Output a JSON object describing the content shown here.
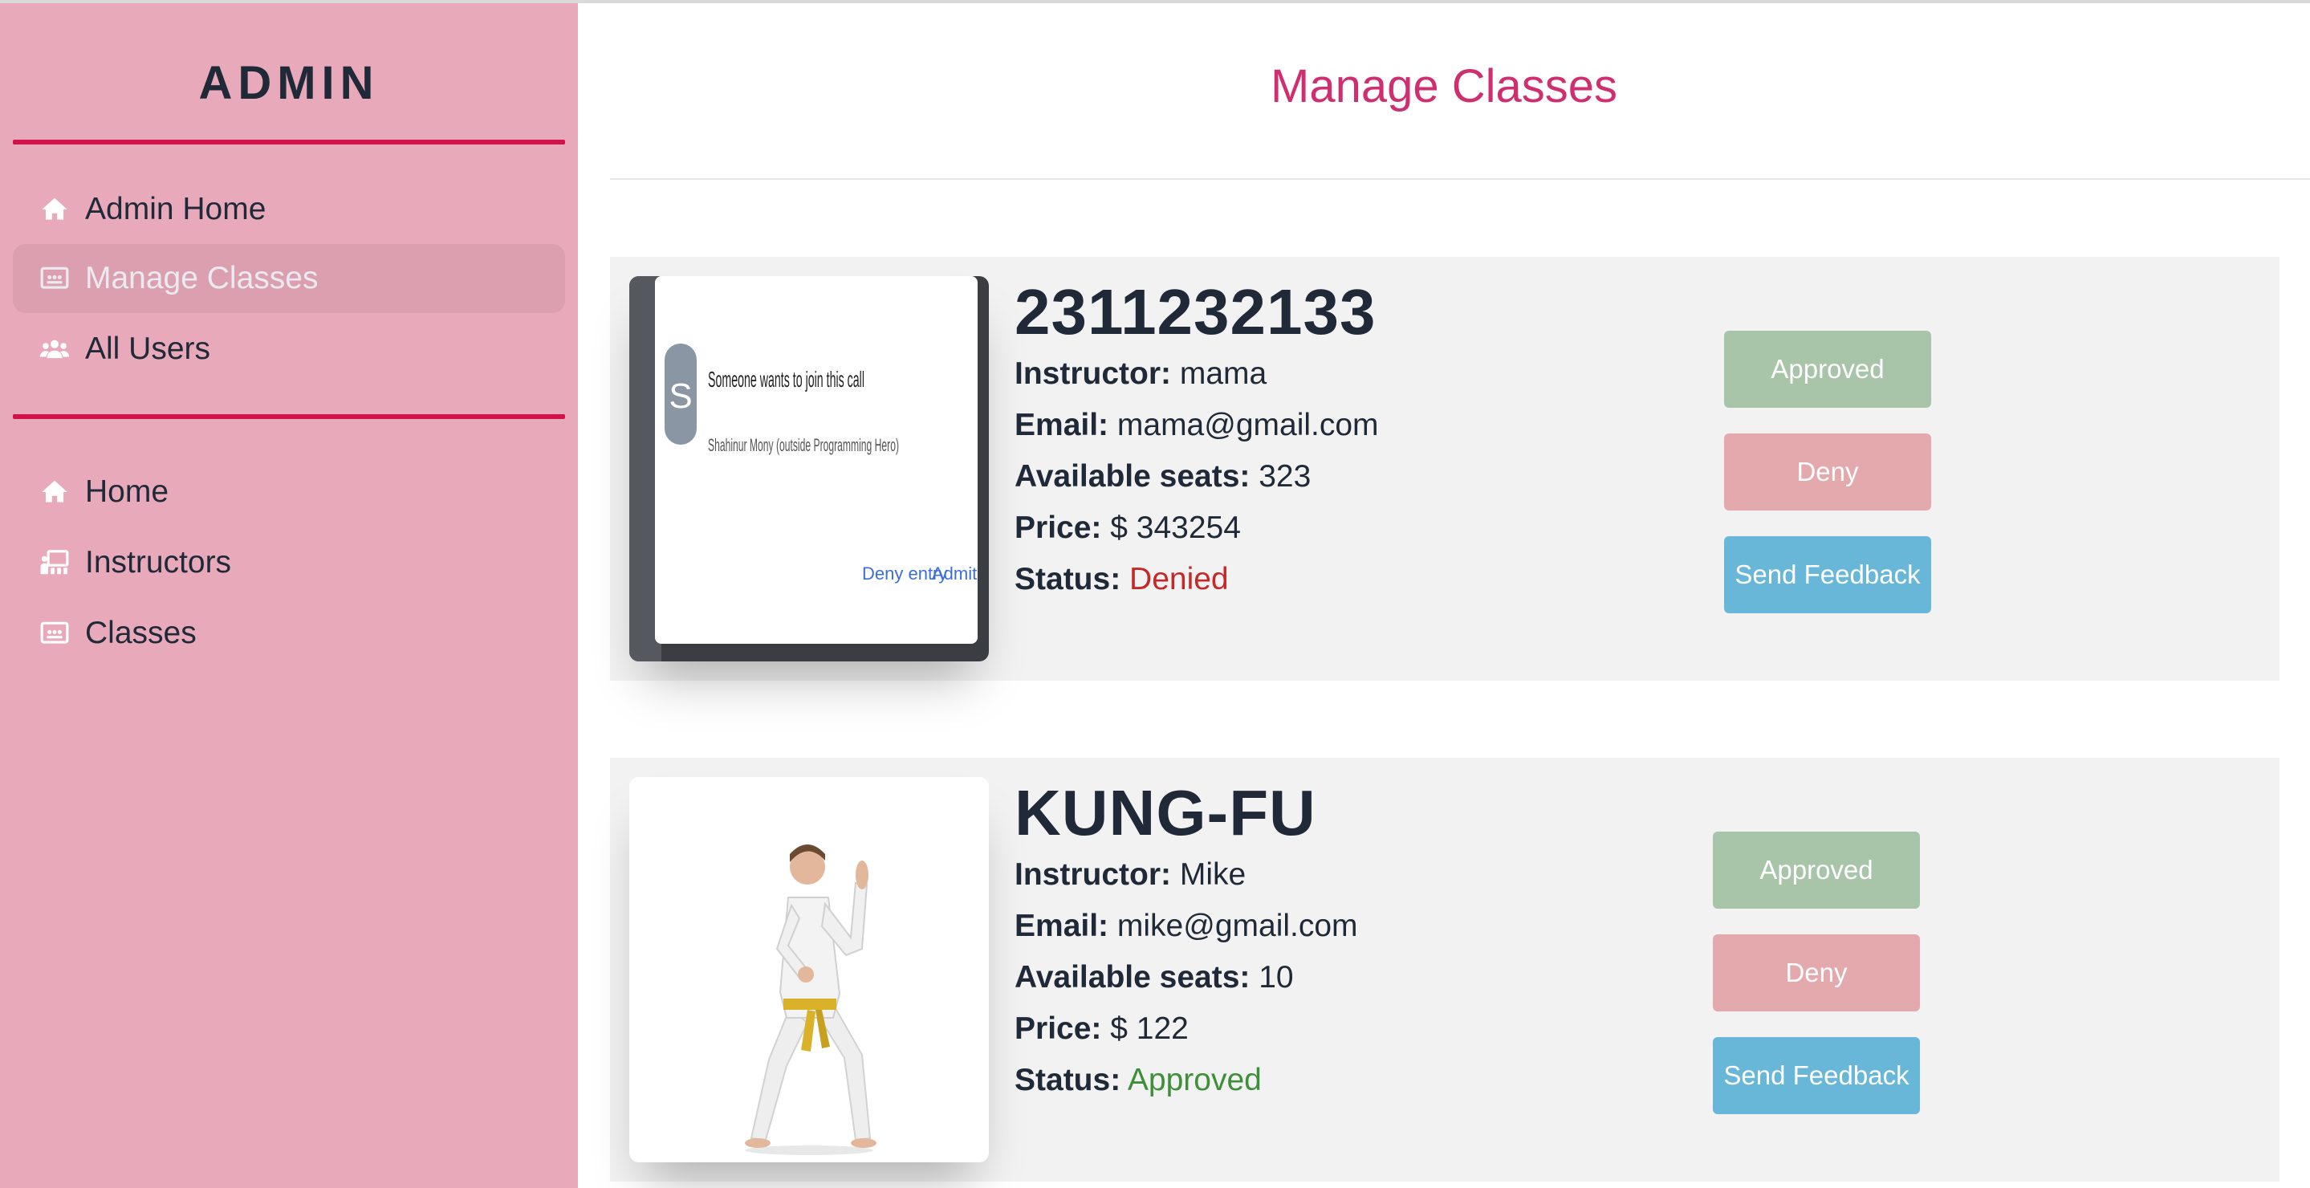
{
  "sidebar": {
    "brand": "ADMIN",
    "admin_items": [
      {
        "label": "Admin Home",
        "icon": "home-icon"
      },
      {
        "label": "Manage Classes",
        "icon": "classes-board-icon",
        "active": true
      },
      {
        "label": "All Users",
        "icon": "users-icon"
      }
    ],
    "site_items": [
      {
        "label": "Home",
        "icon": "home-icon"
      },
      {
        "label": "Instructors",
        "icon": "instructors-icon"
      },
      {
        "label": "Classes",
        "icon": "classes-board-icon"
      }
    ]
  },
  "main": {
    "title": "Manage Classes",
    "labels": {
      "instructor": "Instructor:",
      "email": "Email:",
      "seats": "Available seats:",
      "price": "Price:",
      "status": "Status:"
    },
    "buttons": {
      "approve": "Approved",
      "deny": "Deny",
      "feedback": "Send Feedback"
    },
    "classes": [
      {
        "name": "2311232133",
        "instructor": "mama",
        "email": "mama@gmail.com",
        "seats": "323",
        "price": "$ 343254",
        "status": "Denied",
        "image": {
          "title": "Someone wants to join this call",
          "subtitle": "Shahinur Mony (outside Programming Hero)",
          "avatar_letter": "S",
          "deny_text": "Deny entry",
          "admit_text": "Admit"
        }
      },
      {
        "name": "KUNG-FU",
        "instructor": "Mike",
        "email": "mike@gmail.com",
        "seats": "10",
        "price": "$ 122",
        "status": "Approved",
        "image": {}
      }
    ]
  },
  "colors": {
    "sidebar_bg": "#e8a9bb",
    "divider": "#d0144a",
    "title": "#cf2f6e",
    "denied": "#c62828",
    "approved": "#3f8f3a",
    "approve_btn": "#a9c5a9",
    "deny_btn": "#e4a9ac",
    "feedback_btn": "#68b7d8"
  }
}
